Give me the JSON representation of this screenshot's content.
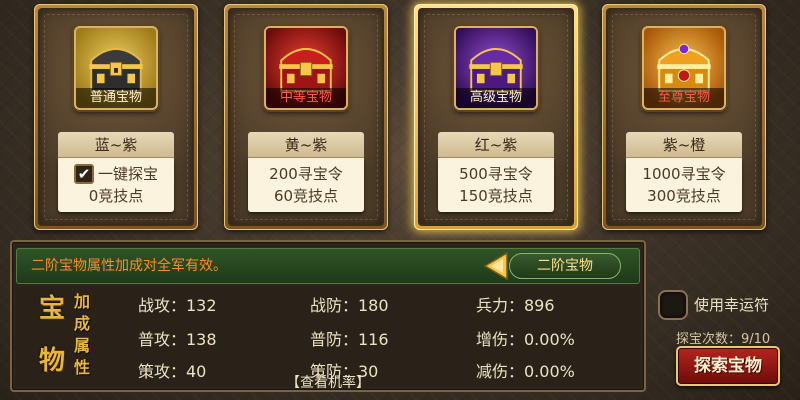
{
  "cards": [
    {
      "name": "普通宝物",
      "range": "蓝~紫",
      "checkbox": true,
      "cost_line1": "一键探宝",
      "cost_line2": "0竞技点",
      "icon": "chest-gold-icon",
      "color_bg": "#c9a22a",
      "label_color": "#fff2cc"
    },
    {
      "name": "中等宝物",
      "range": "黄~紫",
      "cost_line1": "200寻宝令",
      "cost_line2": "60竞技点",
      "icon": "chest-red-icon",
      "color_bg": "#b01818",
      "label_color": "#ff5a4a"
    },
    {
      "name": "高级宝物",
      "range": "红~紫",
      "cost_line1": "500寻宝令",
      "cost_line2": "150竞技点",
      "icon": "chest-purple-icon",
      "color_bg": "#5b1f9a",
      "label_color": "#fff2cc",
      "selected": true
    },
    {
      "name": "至尊宝物",
      "range": "紫~橙",
      "cost_line1": "1000寻宝令",
      "cost_line2": "300竞技点",
      "icon": "chest-orange-icon",
      "color_bg": "#e38a10",
      "label_color": "#ff5a4a"
    }
  ],
  "notice": "二阶宝物属性加成对全军有效。",
  "tier_tag": "二阶宝物",
  "bonus_title": {
    "big1": "宝",
    "big2": "物",
    "small1": "加",
    "small2": "成",
    "small3": "属",
    "small4": "性"
  },
  "attributes": {
    "zhan_gong": "战攻：132",
    "zhan_fang": "战防：180",
    "bing_li": "兵力：896",
    "pu_gong": "普攻：138",
    "pu_fang": "普防：116",
    "zeng_shang": "增伤：0.00%",
    "ce_gong": "策攻：40",
    "ce_fang": "策防：30",
    "jian_shang": "减伤：0.00%"
  },
  "view_rate": "【查看机率】",
  "lucky_label": "使用幸运符",
  "treasure_count": "探宝次数：9/10",
  "explore_button": "探索宝物"
}
